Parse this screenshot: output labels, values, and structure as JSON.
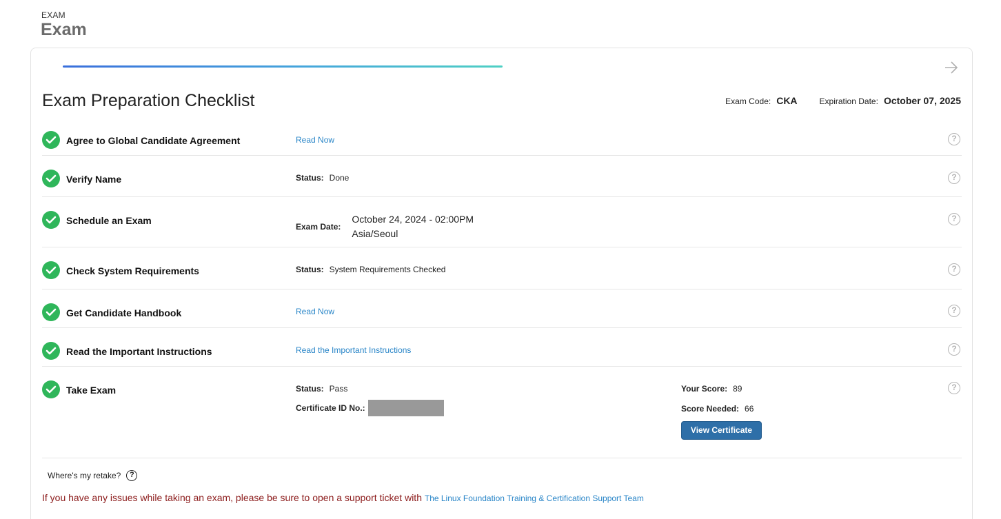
{
  "header": {
    "breadcrumb": "EXAM",
    "title": "Exam"
  },
  "card": {
    "title": "Exam Preparation Checklist",
    "exam_code_label": "Exam Code:",
    "exam_code": "CKA",
    "expiration_label": "Expiration Date:",
    "expiration_date": "October 07, 2025",
    "progress_percent": 100
  },
  "steps": [
    {
      "label": "Agree to Global Candidate Agreement",
      "link": "Read Now"
    },
    {
      "label": "Verify Name",
      "status_label": "Status:",
      "status": "Done"
    },
    {
      "label": "Schedule an Exam",
      "date_label": "Exam Date:",
      "date": "October 24, 2024 - 02:00PM",
      "timezone": "Asia/Seoul"
    },
    {
      "label": "Check System Requirements",
      "status_label": "Status:",
      "status": "System Requirements Checked"
    },
    {
      "label": "Get Candidate Handbook",
      "link": "Read Now"
    },
    {
      "label": "Read the Important Instructions",
      "link": "Read the Important Instructions"
    },
    {
      "label": "Take Exam",
      "status_label": "Status:",
      "status": "Pass",
      "cert_label": "Certificate ID No.:",
      "score_label": "Your Score:",
      "score": "89",
      "needed_label": "Score Needed:",
      "needed": "66",
      "button": "View Certificate"
    }
  ],
  "help_glyph": "?",
  "footer": {
    "retake": "Where's my retake?",
    "issues_text": "If you have any issues while taking an exam, please be sure to open a support ticket with",
    "issues_link": "The Linux Foundation Training & Certification Support Team"
  },
  "colors": {
    "check": "#2fb65a",
    "link": "#2a86c8",
    "button": "#2e6fa8",
    "warning": "#8b1a1a"
  },
  "icons": [
    "check-circle-icon",
    "help-circle-icon",
    "arrow-right-icon"
  ]
}
